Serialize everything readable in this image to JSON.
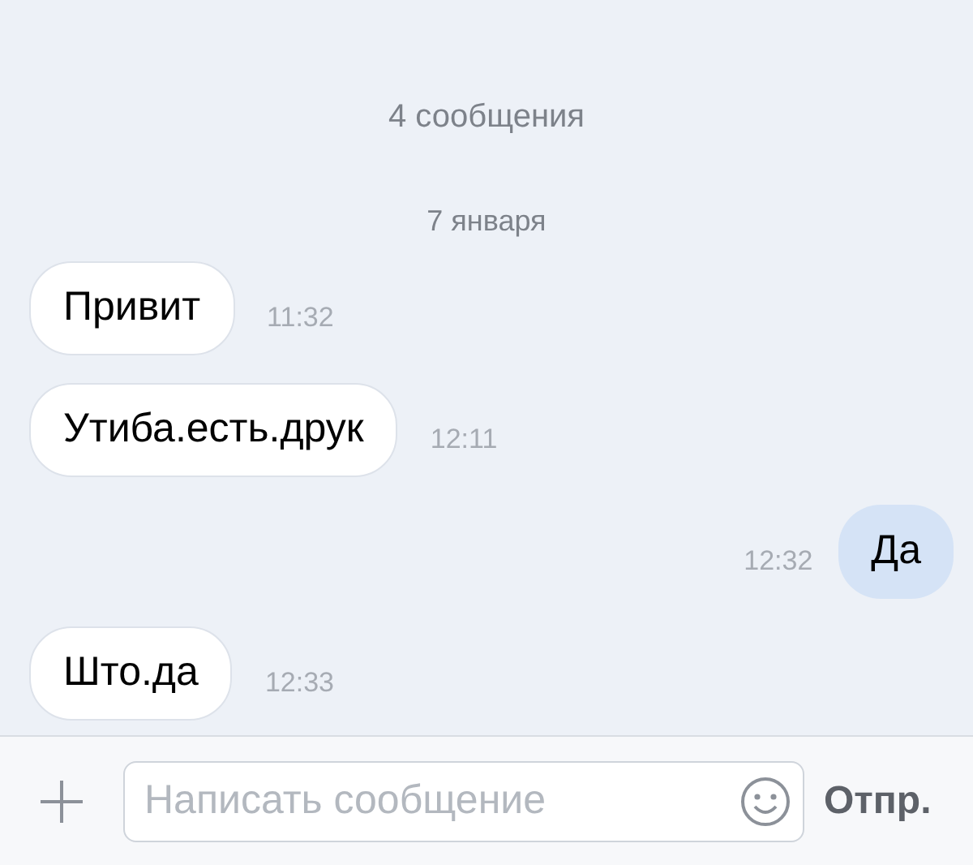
{
  "header": {
    "count": "4 сообщения"
  },
  "date": "7 января",
  "messages": [
    {
      "kind": "incoming",
      "text": "Привит",
      "time": "11:32"
    },
    {
      "kind": "incoming",
      "text": "Утиба.есть.друк",
      "time": "12:11"
    },
    {
      "kind": "outgoing",
      "text": "Да",
      "time": "12:32"
    },
    {
      "kind": "incoming",
      "text": "Што.да",
      "time": "12:33"
    }
  ],
  "composer": {
    "placeholder": "Написать сообщение",
    "send": "Отпр."
  }
}
